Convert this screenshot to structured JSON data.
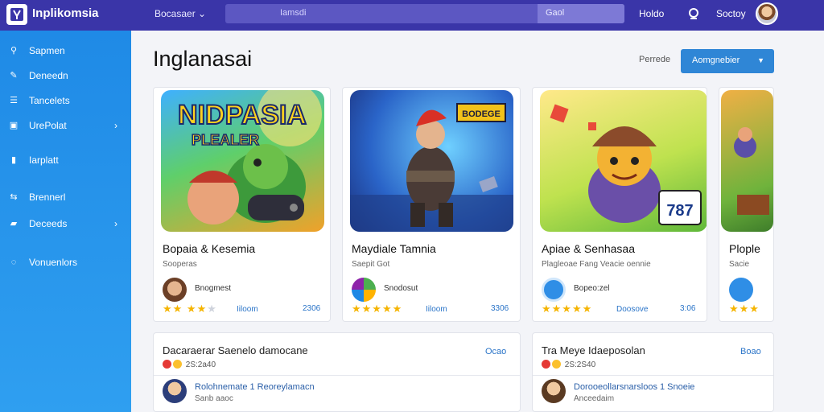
{
  "app": {
    "title": "Inplikomsia"
  },
  "header": {
    "browse_label": "Bocasaer",
    "search_placeholder": "Iamsdi",
    "search_button": "Gaol",
    "help_label": "Holdo",
    "signin_label": "Soctoy"
  },
  "sidebar": {
    "items": [
      {
        "label": "Sapmen",
        "icon": "link-icon"
      },
      {
        "label": "Deneedn",
        "icon": "pen-icon"
      },
      {
        "label": "Tancelets",
        "icon": "list-icon"
      },
      {
        "label": "UrePolat",
        "icon": "grid-icon",
        "chevron": true
      },
      {
        "label": "Iarplatt",
        "icon": "page-icon"
      },
      {
        "label": "Brennerl",
        "icon": "share-icon"
      },
      {
        "label": "Deceeds",
        "icon": "chat-icon",
        "chevron": true
      },
      {
        "label": "Vonuenlors",
        "icon": "bubble-icon"
      }
    ]
  },
  "main": {
    "title": "Inglanasai",
    "filter_label": "Perrede",
    "dropdown_label": "Aomgnebier"
  },
  "cards": [
    {
      "image_text_top": "NIDPASIA",
      "image_text_bottom": "PLEALER",
      "title": "Bopaia & Kesemia",
      "subtitle": "Sooperas",
      "developer": "Bnogmest",
      "rating": 4,
      "link": "Iiloom",
      "price": "2306"
    },
    {
      "image_text_top": "BODEGE",
      "title": "Maydiale Tamnia",
      "subtitle": "Saepit Got",
      "developer": "Snodosut",
      "rating": 5,
      "link": "Iiloom",
      "price": "3306"
    },
    {
      "image_text_top": "787",
      "title": "Apiae & Senhasaa",
      "subtitle": "Plagleoae Fang Veacie oennie",
      "developer": "Bopeo:zel",
      "rating": 5,
      "link": "Doosove",
      "price": "3:06"
    },
    {
      "title": "Plople",
      "subtitle": "Sacie",
      "rating": 3
    }
  ],
  "panels": [
    {
      "title": "Dacaraerar Saenelo damocane",
      "more": "Ocao",
      "meta": "2S:2a40",
      "row_title": "Rolohnemate 1 Reoreylamacn",
      "row_sub": "Sanb aaoc"
    },
    {
      "title": "Tra Meye Idaeposolan",
      "more": "Boao",
      "meta": "2S:2S40",
      "row_title": "Dorooeollarsnarsloos 1 Snoeie",
      "row_sub": "Anceedaim"
    }
  ],
  "colors": {
    "topbar": "#3a35a8",
    "sidebar": "#2090e8",
    "accent": "#2f86d6",
    "star": "#f5b400"
  }
}
